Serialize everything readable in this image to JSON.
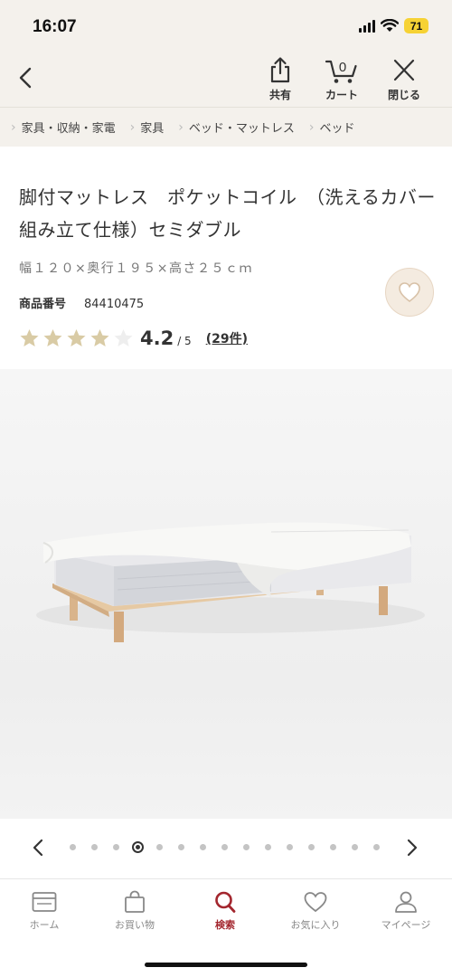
{
  "status_bar": {
    "time": "16:07",
    "battery": "71",
    "battery_color": "#f6d234"
  },
  "header": {
    "back_icon": "chevron-left-icon",
    "actions": [
      {
        "label": "共有",
        "icon": "share-icon"
      },
      {
        "label": "カート",
        "icon": "cart-icon",
        "badge": "0"
      },
      {
        "label": "閉じる",
        "icon": "close-icon"
      }
    ]
  },
  "breadcrumb": [
    "家具・収納・家電",
    "家具",
    "ベッド・マットレス",
    "ベッド"
  ],
  "product": {
    "title": "脚付マットレス　ポケットコイル　（洗えるカバー　組み立て仕様）セミダブル",
    "dimensions": "幅１２０×奥行１９５×高さ２５ｃｍ",
    "product_number_label": "商品番号",
    "product_number": "84410475",
    "rating": {
      "value": "4.2",
      "max": "/ 5",
      "count": "(29件)",
      "stars_filled": 4,
      "stars_total": 5,
      "star_color": "#d9cba5"
    },
    "favorite_icon": "heart-icon"
  },
  "gallery": {
    "total": 15,
    "current": 4,
    "prev_icon": "chevron-left-icon",
    "next_icon": "chevron-right-icon"
  },
  "tabbar": {
    "accent": "#a3262e",
    "tabs": [
      {
        "label": "ホーム",
        "icon": "card-icon",
        "active": false
      },
      {
        "label": "お買い物",
        "icon": "bag-icon",
        "active": false
      },
      {
        "label": "検索",
        "icon": "search-icon",
        "active": true
      },
      {
        "label": "お気に入り",
        "icon": "heart-icon",
        "active": false
      },
      {
        "label": "マイページ",
        "icon": "user-icon",
        "active": false
      }
    ]
  }
}
